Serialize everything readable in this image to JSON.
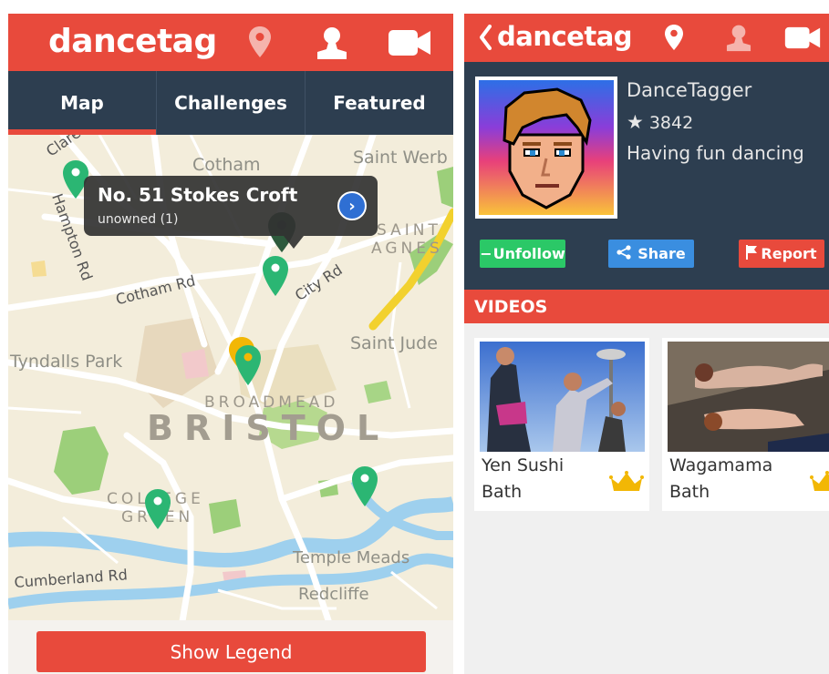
{
  "left": {
    "brand": "dancetag",
    "tabs": [
      {
        "label": "Map",
        "active": true
      },
      {
        "label": "Challenges",
        "active": false
      },
      {
        "label": "Featured",
        "active": false
      }
    ],
    "map": {
      "labels": {
        "clare_rd": "Clare Rd",
        "hampton_rd": "Hampton Rd",
        "cotham": "Cotham",
        "saint_werb": "Saint Werb",
        "saint_agnes_1": "SAINT",
        "saint_agnes_2": "AGNES",
        "cotham_rd": "Cotham Rd",
        "city_rd": "City Rd",
        "saint_jude": "Saint Jude",
        "tyndalls_park": "Tyndalls Park",
        "broadmead": "BROADMEAD",
        "bristol": "BRISTOL",
        "college_green_1": "COLLEGE",
        "college_green_2": "GREEN",
        "temple_meads": "Temple Meads",
        "cumberland_rd": "Cumberland Rd",
        "redcliffe": "Redcliffe"
      },
      "callout": {
        "title": "No. 51 Stokes Croft",
        "subtitle": "unowned (1)"
      }
    },
    "legend_button": "Show Legend"
  },
  "right": {
    "brand": "dancetag",
    "profile": {
      "username": "DanceTagger",
      "stars": "3842",
      "bio": "Having fun dancing"
    },
    "actions": {
      "unfollow": "Unfollow",
      "share": "Share",
      "report": "Report"
    },
    "videos_header": "VIDEOS",
    "videos": [
      {
        "title": "Yen Sushi",
        "location": "Bath"
      },
      {
        "title": "Wagamama",
        "location": "Bath"
      }
    ]
  },
  "colors": {
    "brand_red": "#e84a3c",
    "navy": "#2d3e50",
    "pin_green": "#2bb673",
    "follow_green": "#2bc867",
    "share_blue": "#3a8ee0",
    "crown_gold": "#f2b705"
  },
  "icons": [
    "location-pin-icon",
    "user-icon",
    "video-camera-icon",
    "back-chevron-icon",
    "star-icon",
    "share-icon",
    "flag-icon",
    "crown-icon",
    "chevron-right-icon"
  ]
}
